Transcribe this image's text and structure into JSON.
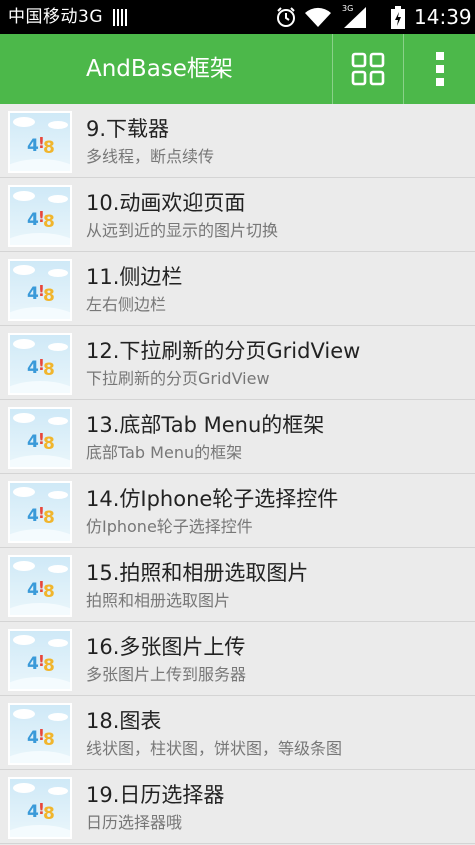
{
  "status_bar": {
    "carrier": "中国移动3G",
    "time": "14:39",
    "network_tag": "3G",
    "icons": [
      "barcode-icon",
      "alarm-icon",
      "wifi-icon",
      "signal-icon",
      "battery-icon"
    ]
  },
  "action_bar": {
    "title": "AndBase框架",
    "background_color": "#4cb84a",
    "grid_icon": "grid-icon",
    "overflow_icon": "overflow-menu-icon"
  },
  "list": {
    "items": [
      {
        "title": "9.下载器",
        "subtitle": "多线程，断点续传"
      },
      {
        "title": "10.动画欢迎页面",
        "subtitle": "从远到近的显示的图片切换"
      },
      {
        "title": "11.侧边栏",
        "subtitle": "左右侧边栏"
      },
      {
        "title": "12.下拉刷新的分页GridView",
        "subtitle": "下拉刷新的分页GridView"
      },
      {
        "title": "13.底部Tab Menu的框架",
        "subtitle": "底部Tab Menu的框架"
      },
      {
        "title": "14.仿Iphone轮子选择控件",
        "subtitle": "仿Iphone轮子选择控件"
      },
      {
        "title": "15.拍照和相册选取图片",
        "subtitle": "拍照和相册选取图片"
      },
      {
        "title": "16.多张图片上传",
        "subtitle": "多张图片上传到服务器"
      },
      {
        "title": "18.图表",
        "subtitle": "线状图，柱状图，饼状图，等级条图"
      },
      {
        "title": "19.日历选择器",
        "subtitle": "日历选择器哦"
      }
    ]
  }
}
